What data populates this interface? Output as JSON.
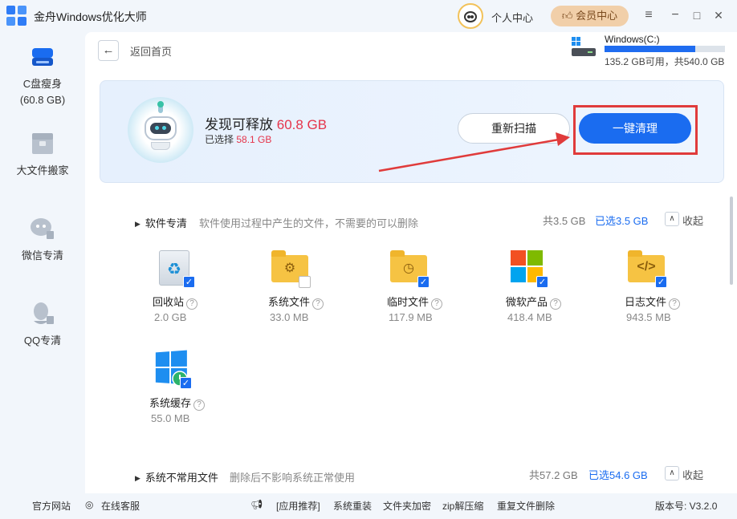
{
  "app": {
    "title": "金舟Windows优化大师"
  },
  "header": {
    "personal_center": "个人中心",
    "vip_center": "会员中心",
    "vip_icon": "thumbs-up-icon"
  },
  "window_controls": {
    "menu": "≡",
    "minimize": "−",
    "maximize": "□",
    "close": "✕"
  },
  "sidebar": {
    "items": [
      {
        "label": "C盘瘦身",
        "sub": "(60.8 GB)",
        "icon": "disk-icon"
      },
      {
        "label": "大文件搬家",
        "icon": "box-icon"
      },
      {
        "label": "微信专清",
        "icon": "wechat-brush-icon"
      },
      {
        "label": "QQ专清",
        "icon": "qq-brush-icon"
      }
    ]
  },
  "nav": {
    "back_label": "返回首页"
  },
  "drive": {
    "name": "Windows(C:)",
    "usage_text": "135.2 GB可用，共540.0 GB",
    "used_fraction": 0.75
  },
  "scan": {
    "found_prefix": "发现可释放 ",
    "found_value": "60.8 GB",
    "selected_prefix": "已选择 ",
    "selected_value": "58.1 GB",
    "rescan_label": "重新扫描",
    "clean_label": "一键清理"
  },
  "sections": [
    {
      "title": "软件专清",
      "desc": "软件使用过程中产生的文件，不需要的可以删除",
      "total": "共3.5 GB",
      "selected": "已选3.5 GB",
      "collapse_label": "收起",
      "items": [
        {
          "name": "回收站",
          "size": "2.0 GB",
          "checked": true
        },
        {
          "name": "系统文件",
          "size": "33.0 MB",
          "checked": false
        },
        {
          "name": "临时文件",
          "size": "117.9 MB",
          "checked": true
        },
        {
          "name": "微软产品",
          "size": "418.4 MB",
          "checked": true
        },
        {
          "name": "日志文件",
          "size": "943.5 MB",
          "checked": true
        },
        {
          "name": "系统缓存",
          "size": "55.0 MB",
          "checked": true
        }
      ]
    },
    {
      "title": "系统不常用文件",
      "desc": "删除后不影响系统正常使用",
      "total": "共57.2 GB",
      "selected": "已选54.6 GB",
      "collapse_label": "收起"
    }
  ],
  "footer": {
    "official_site": "官方网站",
    "online_service": "在线客服",
    "app_recommend": "[应用推荐]",
    "links": [
      "系统重装",
      "文件夹加密",
      "zip解压缩",
      "重复文件删除"
    ],
    "version": "版本号: V3.2.0"
  }
}
